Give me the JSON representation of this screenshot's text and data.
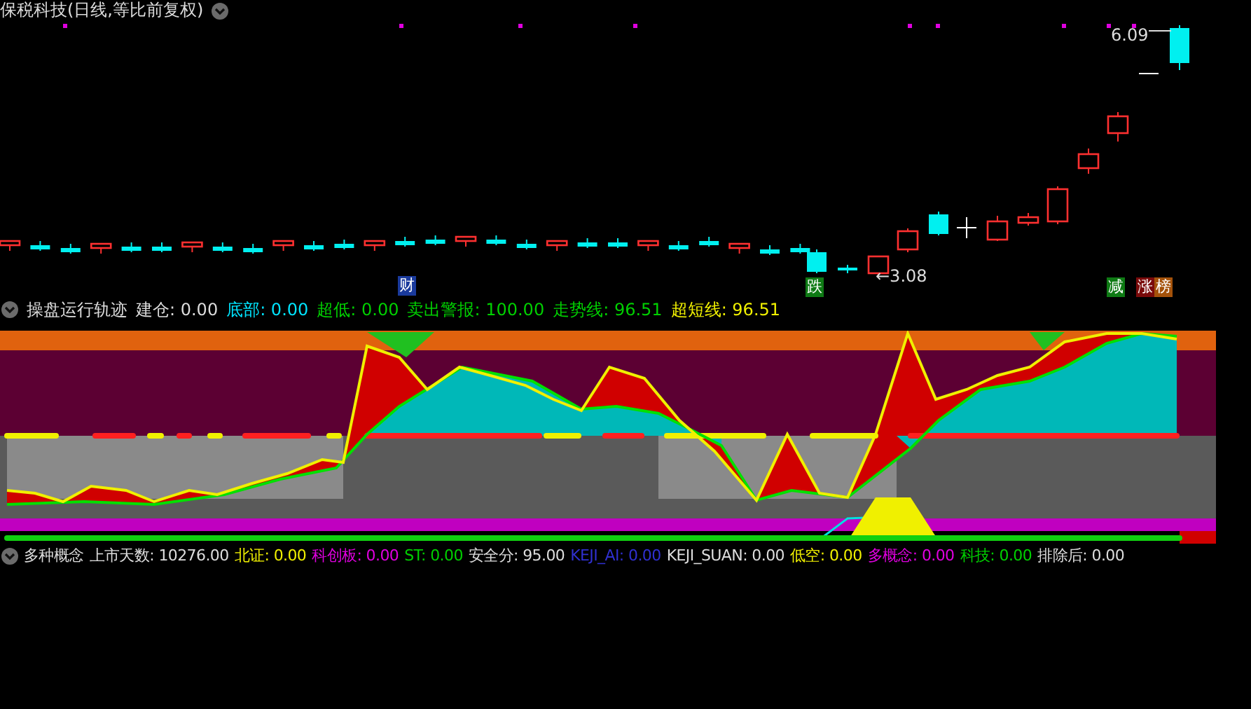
{
  "title": "保税科技(日线,等比前复权)",
  "price_chart": {
    "high_label": "6.09",
    "low_label": "←3.08",
    "markers": [
      {
        "text": "财",
        "color": "#1a3a9c"
      },
      {
        "text": "跌",
        "color": "#0e7a14"
      },
      {
        "text": "减",
        "color": "#0e7a14"
      },
      {
        "text": "涨",
        "color": "#7a0a0a"
      },
      {
        "text": "榜",
        "color": "#a4520a"
      }
    ]
  },
  "indicator": {
    "title": "操盘运行轨迹",
    "items": [
      {
        "text": "建仓: 0.00",
        "color": "#dddddd"
      },
      {
        "text": "底部: 0.00",
        "color": "#00e5ff"
      },
      {
        "text": "超低: 0.00",
        "color": "#00d000"
      },
      {
        "text": "卖出警报: 100.00",
        "color": "#00d000"
      },
      {
        "text": "走势线: 96.51",
        "color": "#00d000"
      },
      {
        "text": "超短线: 96.51",
        "color": "#f0f000"
      }
    ]
  },
  "concepts": {
    "title": "多种概念",
    "items": [
      {
        "text": "上市天数: 10276.00",
        "color": "#dddddd"
      },
      {
        "text": "北证: 0.00",
        "color": "#f0f000"
      },
      {
        "text": "科创板: 0.00",
        "color": "#e000e0"
      },
      {
        "text": "ST: 0.00",
        "color": "#00d000"
      },
      {
        "text": "安全分: 95.00",
        "color": "#dddddd"
      },
      {
        "text": "KEJI_AI: 0.00",
        "color": "#3030d0"
      },
      {
        "text": "KEJI_SUAN: 0.00",
        "color": "#dddddd"
      },
      {
        "text": "低空: 0.00",
        "color": "#f0f000"
      },
      {
        "text": "多概念: 0.00",
        "color": "#e000e0"
      },
      {
        "text": "科技: 0.00",
        "color": "#00d000"
      },
      {
        "text": "排除后: 0.00",
        "color": "#dddddd"
      }
    ]
  }
}
